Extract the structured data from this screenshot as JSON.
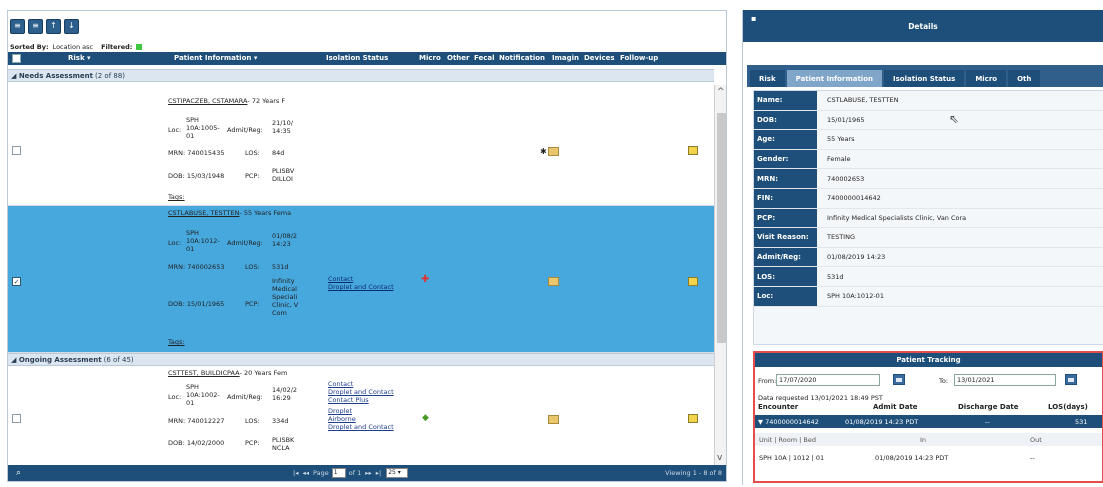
{
  "toolbar": {
    "buttons": [
      {
        "glyph": "≡",
        "name": "list-view-button"
      },
      {
        "glyph": "≡",
        "name": "group-view-button"
      },
      {
        "glyph": "↑",
        "name": "sort-up-button"
      },
      {
        "glyph": "↓",
        "name": "sort-down-button"
      }
    ],
    "sorted_label": "Sorted By:",
    "sorted_value": "Location asc",
    "filtered_label": "Filtered:"
  },
  "grid": {
    "columns": [
      "Risk ▾",
      "Patient Information ▾",
      "Isolation Status",
      "Micro",
      "Other",
      "Fecal",
      "Notification",
      "Imagin",
      "Devices",
      "Follow-up"
    ],
    "groups": [
      {
        "title": "Needs Assessment",
        "count": "(2 of 88)"
      },
      {
        "title": "Ongoing Assessment",
        "count": "(6 of 45)"
      }
    ],
    "patients": [
      {
        "name": "CSTIPACZEB, CSTAMARA",
        "age_sex": " - 72 Years F",
        "loc_label": "Loc:",
        "loc_lines": [
          "SPH",
          "10A:1005-",
          "01"
        ],
        "admit_label": "Admit/Reg:",
        "admit_lines": [
          "21/10/",
          "14:35"
        ],
        "mrn": "MRN: 740015435",
        "los_label": "LOS:",
        "los": "84d",
        "dob": "DOB: 15/03/1948",
        "pcp_label": "PCP:",
        "pcp_lines": [
          "PLISBV",
          "DILLOI"
        ],
        "tags": "Tags:",
        "isolation": [],
        "micro_icon": "",
        "notif_star": "✱"
      },
      {
        "name": "CSTLABUSE, TESTTEN",
        "age_sex": " - 55 Years Fema",
        "loc_label": "Loc:",
        "loc_lines": [
          "SPH",
          "10A:1012-",
          "01"
        ],
        "admit_label": "Admit/Reg:",
        "admit_lines": [
          "01/08/2",
          "14:23"
        ],
        "mrn": "MRN: 740002653",
        "los_label": "LOS:",
        "los": "531d",
        "dob": "DOB: 15/01/1965",
        "pcp_label": "PCP:",
        "pcp_lines": [
          "Infinity",
          "Medical",
          "Speciali",
          "Clinic, V",
          "Com"
        ],
        "tags": "Tags:",
        "isolation": [
          "Contact",
          "Droplet and Contact"
        ],
        "micro_icon": "✚",
        "notif_star": ""
      },
      {
        "name": "CSTTEST, BUILDICPAA",
        "age_sex": " - 20 Years Fem",
        "loc_label": "Loc:",
        "loc_lines": [
          "SPH",
          "10A:1002-",
          "01"
        ],
        "admit_label": "Admit/Reg:",
        "admit_lines": [
          "14/02/2",
          "16:29"
        ],
        "mrn": "MRN: 740012227",
        "los_label": "LOS:",
        "los": "334d",
        "dob": "DOB: 14/02/2000",
        "pcp_label": "PCP:",
        "pcp_lines": [
          "PLISBK",
          "NCLA"
        ],
        "tags": "Tags:",
        "isolation": [
          "Contact",
          "Droplet and Contact",
          "Contact Plus",
          "Droplet",
          "Airborne",
          "Droplet and Contact"
        ],
        "micro_icon": "◆",
        "notif_star": ""
      }
    ]
  },
  "pager": {
    "page_label": "Page",
    "page_value": "1",
    "of_label": "of 1",
    "page_size": "25",
    "viewing": "Viewing 1 - 8 of 8"
  },
  "details": {
    "title": "Details",
    "tabs": [
      "Risk",
      "Patient Information",
      "Isolation Status",
      "Micro",
      "Oth"
    ],
    "active_tab": 1,
    "fields": [
      {
        "label": "Name:",
        "value": "CSTLABUSE, TESTTEN"
      },
      {
        "label": "DOB:",
        "value": "15/01/1965"
      },
      {
        "label": "Age:",
        "value": "55 Years"
      },
      {
        "label": "Gender:",
        "value": "Female"
      },
      {
        "label": "MRN:",
        "value": "740002653"
      },
      {
        "label": "FIN:",
        "value": "7400000014642"
      },
      {
        "label": "PCP:",
        "value": "Infinity Medical Specialists Clinic, Van Cora"
      },
      {
        "label": "Visit Reason:",
        "value": "TESTING"
      },
      {
        "label": "Admit/Reg:",
        "value": "01/08/2019 14:23"
      },
      {
        "label": "LOS:",
        "value": "531d"
      },
      {
        "label": "Loc:",
        "value": "SPH 10A:1012-01"
      }
    ]
  },
  "tracking": {
    "title": "Patient Tracking",
    "from_label": "From:",
    "from_value": "17/07/2020",
    "to_label": "To:",
    "to_value": "13/01/2021",
    "requested": "Data requested 13/01/2021 18:49 PST",
    "columns": {
      "encounter": "Encounter",
      "admit": "Admit Date",
      "discharge": "Discharge Date",
      "los": "LOS(days)"
    },
    "encounter_row": {
      "id": "▼ 7400000014642",
      "admit": "01/08/2019 14:23 PDT",
      "discharge": "--",
      "los": "531"
    },
    "sub_headers": {
      "unit": "Unit | Room | Bed",
      "in": "In",
      "out": "Out"
    },
    "data_row": {
      "unit": "SPH 10A | 1012 | 01",
      "in": "01/08/2019 14:23 PDT",
      "out": "--"
    }
  }
}
